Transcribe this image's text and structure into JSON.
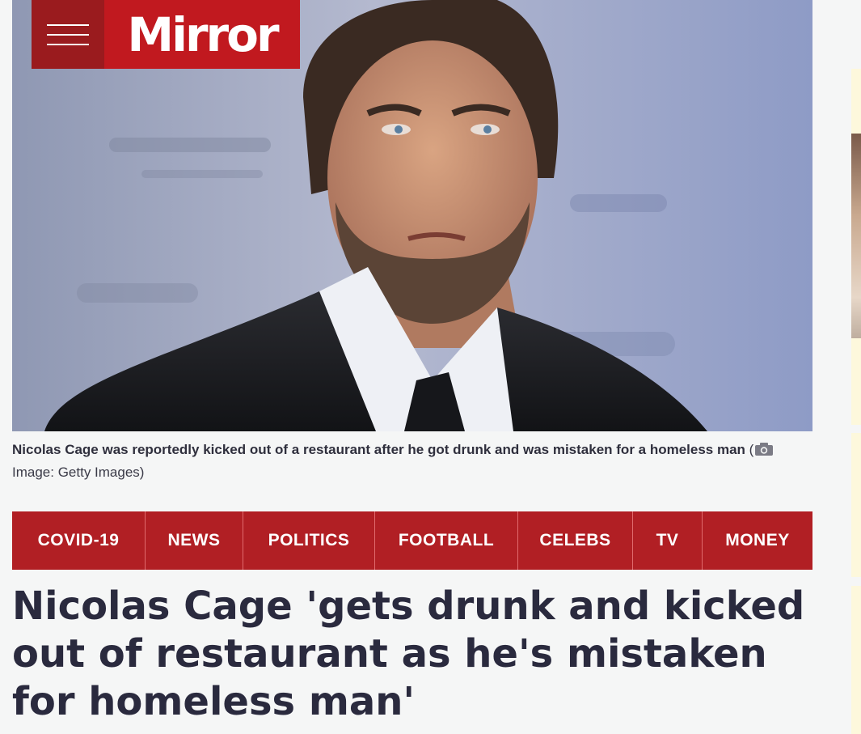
{
  "brand": {
    "logo_text": "Mirror",
    "primary_color": "#c1191f",
    "menu_color": "#9a1b1e"
  },
  "hero": {
    "caption": "Nicolas Cage was reportedly kicked out of a restaurant after he got drunk and was mistaken for a homeless man",
    "credit_open": "(",
    "credit": "Image: Getty Images)",
    "camera_icon": "camera-icon"
  },
  "nav": {
    "items": [
      "COVID-19",
      "NEWS",
      "POLITICS",
      "FOOTBALL",
      "CELEBS",
      "TV",
      "MONEY"
    ],
    "background": "#b11f24"
  },
  "article": {
    "headline": "Nicolas Cage 'gets drunk and kicked out of restaurant as he's mistaken for homeless man'"
  }
}
